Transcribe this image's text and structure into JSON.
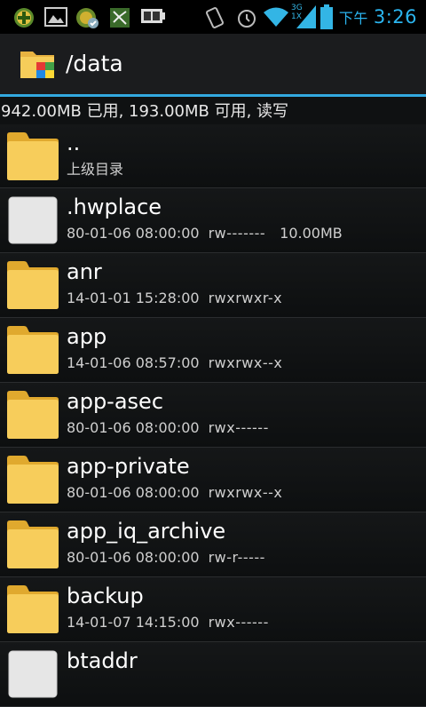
{
  "status_bar": {
    "ampm": "下午",
    "time": "3:26",
    "network_badge_top": "3G",
    "network_badge_bottom": "1X",
    "icons": [
      "app-notification-icon",
      "gallery-icon",
      "sync-icon",
      "game-icon",
      "battery-status-icon",
      "vibrate-icon",
      "alarm-icon",
      "wifi-icon",
      "signal-icon",
      "battery-icon"
    ]
  },
  "header": {
    "title": "/data"
  },
  "storage_info": "942.00MB 已用, 193.00MB 可用, 读写",
  "files": [
    {
      "name": "..",
      "date": "",
      "perm": "",
      "size": "",
      "sub": "上级目录",
      "type": "folder"
    },
    {
      "name": ".hwplace",
      "date": "80-01-06 08:00:00",
      "perm": "rw-------",
      "size": "10.00MB",
      "type": "file"
    },
    {
      "name": "anr",
      "date": "14-01-01 15:28:00",
      "perm": "rwxrwxr-x",
      "size": "",
      "type": "folder"
    },
    {
      "name": "app",
      "date": "14-01-06 08:57:00",
      "perm": "rwxrwx--x",
      "size": "",
      "type": "folder"
    },
    {
      "name": "app-asec",
      "date": "80-01-06 08:00:00",
      "perm": "rwx------",
      "size": "",
      "type": "folder"
    },
    {
      "name": "app-private",
      "date": "80-01-06 08:00:00",
      "perm": "rwxrwx--x",
      "size": "",
      "type": "folder"
    },
    {
      "name": "app_iq_archive",
      "date": "80-01-06 08:00:00",
      "perm": "rw-r-----",
      "size": "",
      "type": "folder"
    },
    {
      "name": "backup",
      "date": "14-01-07 14:15:00",
      "perm": "rwx------",
      "size": "",
      "type": "folder"
    },
    {
      "name": "btaddr",
      "date": "",
      "perm": "",
      "size": "",
      "type": "file"
    }
  ]
}
